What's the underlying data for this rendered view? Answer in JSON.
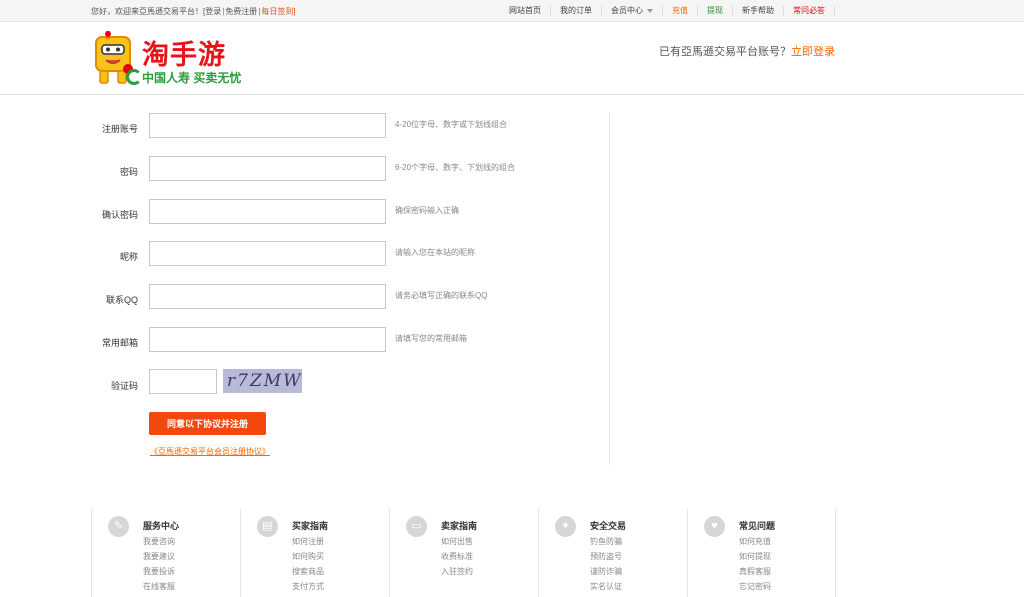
{
  "topbar": {
    "welcome": "您好，欢迎来亞馬遜交易平台！",
    "login": "[登录",
    "register": "免费注册",
    "checkin": "每日签到]",
    "nav": [
      {
        "label": "网站首页",
        "color": "normal"
      },
      {
        "label": "我的订单",
        "color": "normal"
      },
      {
        "label": "会员中心",
        "color": "normal",
        "dropdown": true
      },
      {
        "label": "充值",
        "color": "orange"
      },
      {
        "label": "提现",
        "color": "green"
      },
      {
        "label": "新手帮助",
        "color": "normal"
      },
      {
        "label": "常问必答",
        "color": "red"
      }
    ]
  },
  "header": {
    "logo_title": "淘手游",
    "logo_slogan": "中国人寿  买卖无忧",
    "login_prompt": "已有亞馬遜交易平台账号？",
    "login_link": "立即登录"
  },
  "form": {
    "fields": [
      {
        "label": "注册账号",
        "hint": "4-20位字母、数字或下划线组合",
        "value": ""
      },
      {
        "label": "密码",
        "hint": "6-20个字母、数字、下划线的组合",
        "value": ""
      },
      {
        "label": "确认密码",
        "hint": "确保密码输入正确",
        "value": ""
      },
      {
        "label": "昵称",
        "hint": "请输入您在本站的昵称",
        "value": ""
      },
      {
        "label": "联系QQ",
        "hint": "请务必填写正确的联系QQ",
        "value": ""
      },
      {
        "label": "常用邮箱",
        "hint": "请填写您的常用邮箱",
        "value": ""
      }
    ],
    "captcha_label": "验证码",
    "captcha_text": "r7ZMW",
    "submit_label": "同意以下协议并注册",
    "agreement_link": "《亞馬遜交易平台会员注册协议》"
  },
  "footer": {
    "columns": [
      {
        "title": "服务中心",
        "icon": "pencil-icon",
        "glyph": "✎",
        "links": [
          "我要咨询",
          "我要建议",
          "我要投诉",
          "在线客服"
        ]
      },
      {
        "title": "买家指南",
        "icon": "bus-icon",
        "glyph": "▤",
        "links": [
          "如何注册",
          "如何购买",
          "搜索商品",
          "支付方式"
        ]
      },
      {
        "title": "卖家指南",
        "icon": "chat-icon",
        "glyph": "▭",
        "links": [
          "如何出售",
          "收费标准",
          "入驻签约"
        ]
      },
      {
        "title": "安全交易",
        "icon": "wrench-icon",
        "glyph": "✦",
        "links": [
          "钓鱼防骗",
          "预防盗号",
          "谨防诈骗",
          "实名认证"
        ]
      },
      {
        "title": "常见问题",
        "icon": "heart-icon",
        "glyph": "♥",
        "links": [
          "如何充值",
          "如何提现",
          "真假客服",
          "忘记密码"
        ]
      }
    ]
  }
}
